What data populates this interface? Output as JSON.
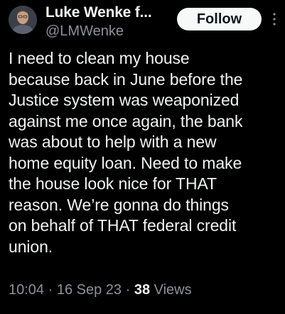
{
  "author": {
    "display_name": "Luke Wenke f...",
    "handle": "@LMWenke",
    "avatar_icon": "profile-photo"
  },
  "actions": {
    "follow_label": "Follow",
    "more_icon": "vertical-ellipsis-icon"
  },
  "tweet": {
    "text": "I need to clean my house\nbecause back in June before the\nJustice system was weaponized\nagainst me once again, the bank\nwas about to help with a new\nhome equity loan.  Need to make\nthe house look nice for THAT\nreason.  We’re gonna do things\non behalf of THAT federal credit\nunion."
  },
  "meta": {
    "time": "10:04",
    "sep1": " · ",
    "date": "16 Sep 23",
    "sep2": " · ",
    "views_count": "38",
    "views_label": " Views"
  },
  "colors": {
    "background": "#000000",
    "primary_text": "#f1f3f4",
    "secondary_text": "#8b9299",
    "follow_button_bg": "#f7f9f9",
    "follow_button_text": "#0f1419"
  }
}
